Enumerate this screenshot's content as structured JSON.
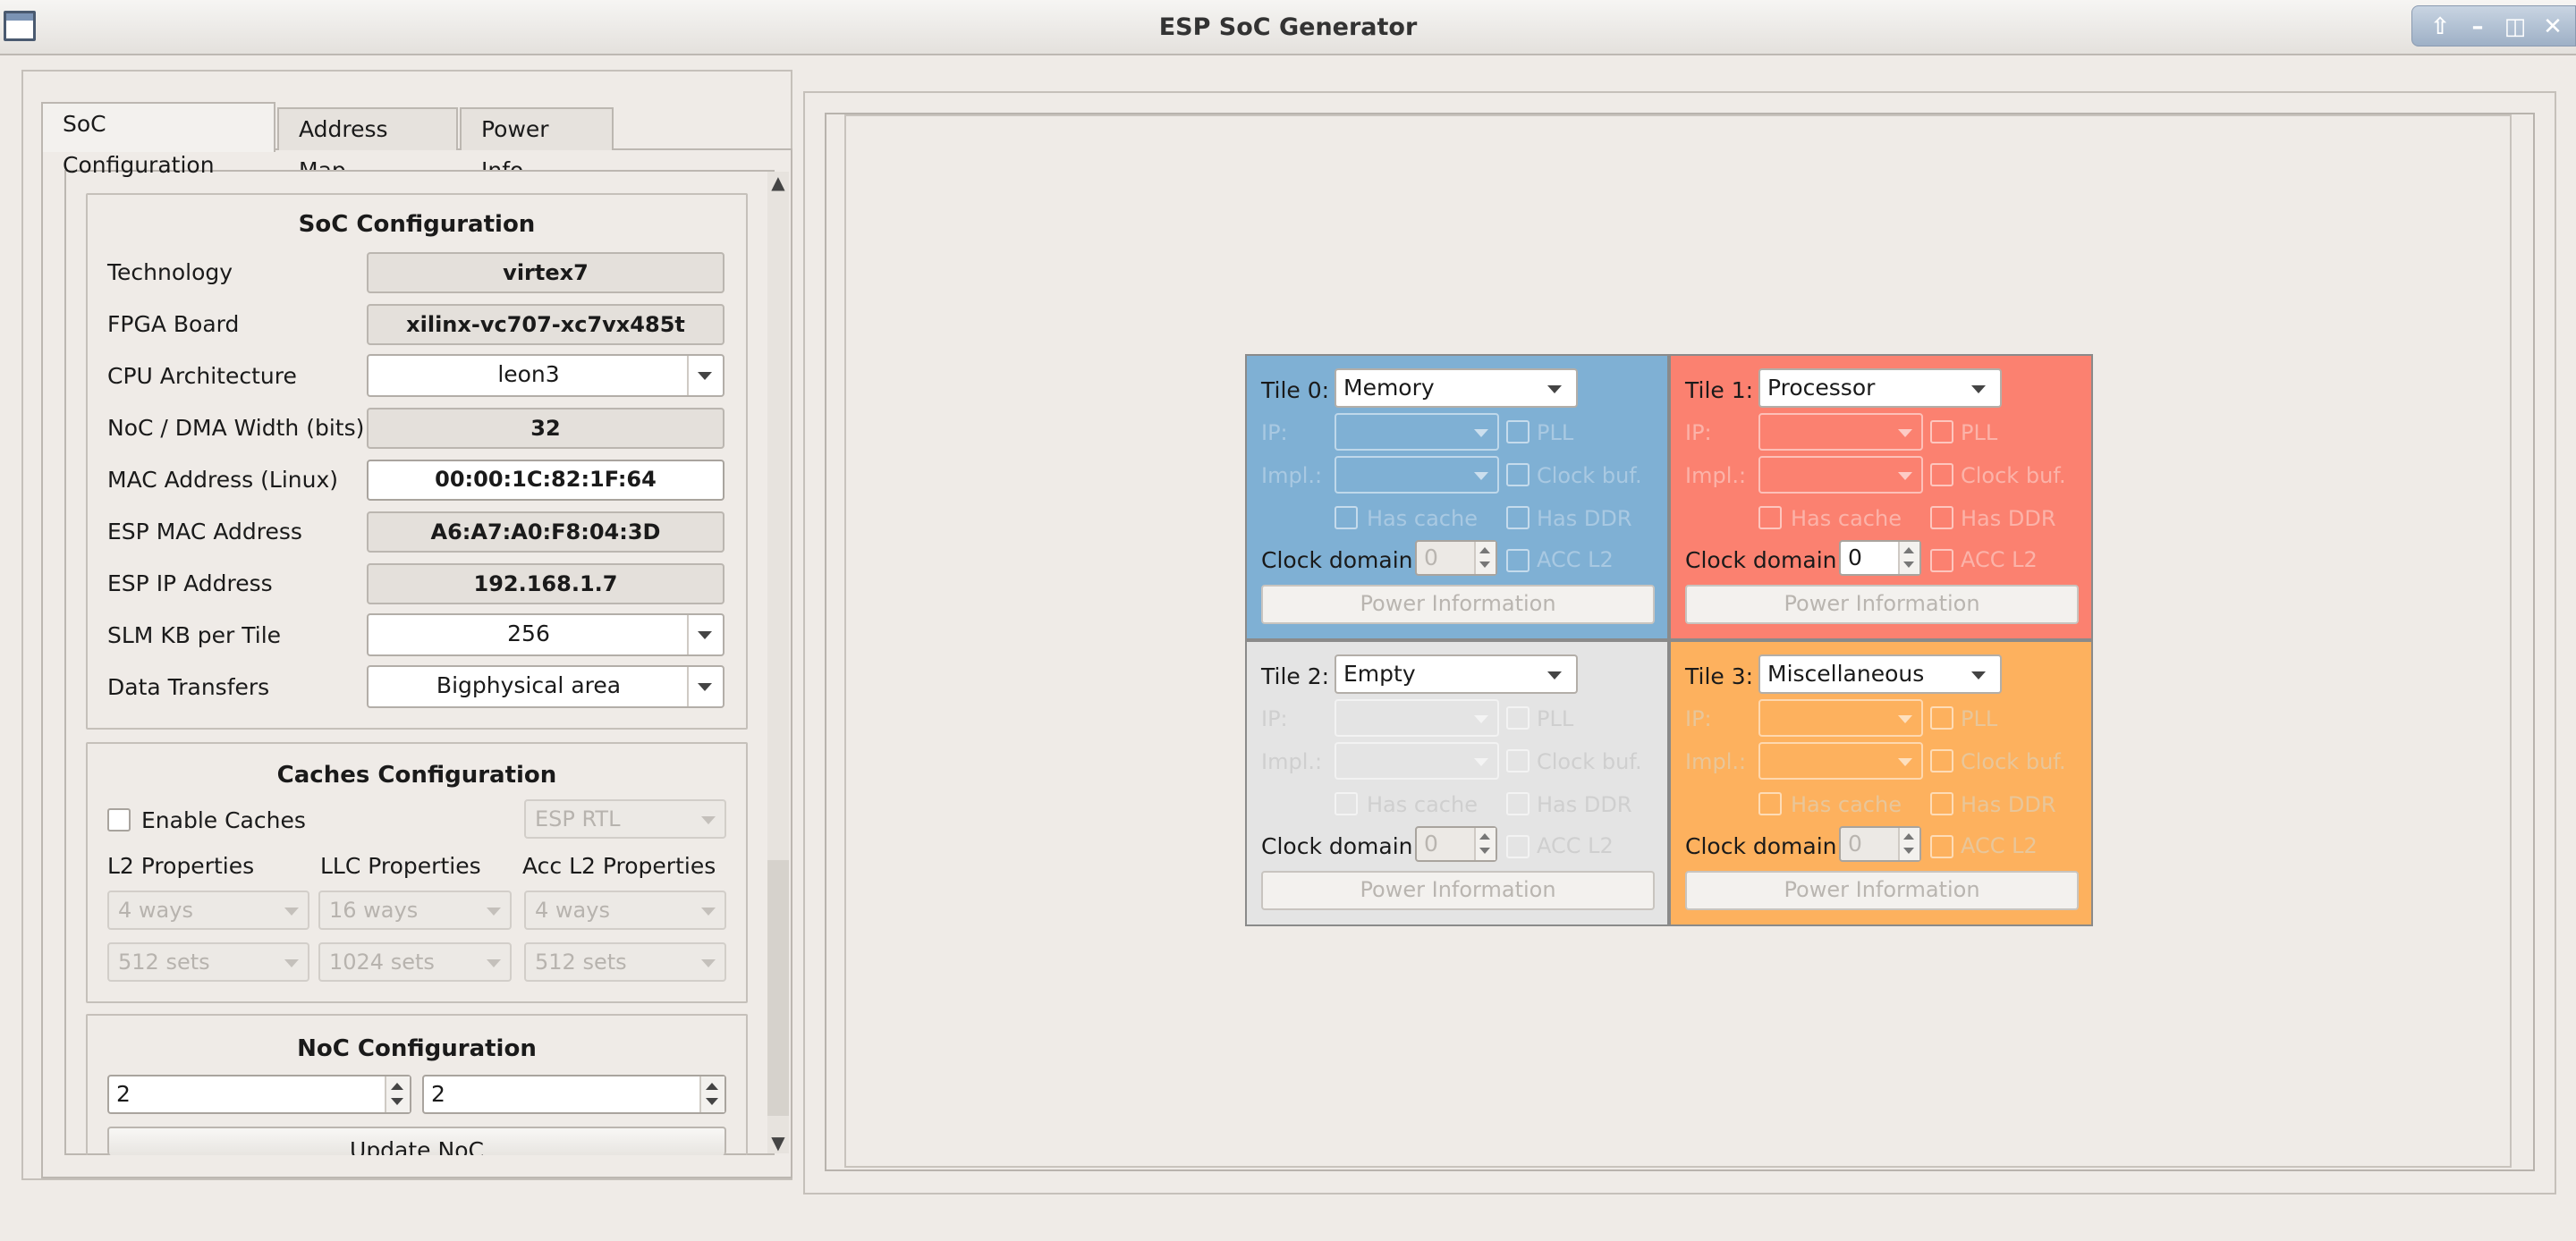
{
  "window": {
    "title": "ESP SoC Generator"
  },
  "tabs": [
    {
      "label": "SoC Configuration"
    },
    {
      "label": "Address Map"
    },
    {
      "label": "Power Info"
    }
  ],
  "soc": {
    "title": "SoC Configuration",
    "technology": {
      "label": "Technology",
      "value": "virtex7"
    },
    "fpga_board": {
      "label": "FPGA Board",
      "value": "xilinx-vc707-xc7vx485t"
    },
    "cpu_arch": {
      "label": "CPU Architecture",
      "value": "leon3"
    },
    "noc_width": {
      "label": "NoC / DMA Width (bits)",
      "value": "32"
    },
    "mac_linux": {
      "label": "MAC Address (Linux)",
      "value": "00:00:1C:82:1F:64"
    },
    "esp_mac": {
      "label": "ESP MAC Address",
      "value": "A6:A7:A0:F8:04:3D"
    },
    "esp_ip": {
      "label": "ESP IP Address",
      "value": "192.168.1.7"
    },
    "slm_kb": {
      "label": "SLM KB per Tile",
      "value": "256"
    },
    "data_transfers": {
      "label": "Data Transfers",
      "value": "Bigphysical area"
    }
  },
  "caches": {
    "title": "Caches Configuration",
    "enable_label": "Enable Caches",
    "impl": "ESP RTL",
    "l2_label": "L2 Properties",
    "llc_label": "LLC Properties",
    "accl2_label": "Acc L2 Properties",
    "l2_ways": "4 ways",
    "llc_ways": "16 ways",
    "accl2_ways": "4 ways",
    "l2_sets": "512 sets",
    "llc_sets": "1024 sets",
    "accl2_sets": "512 sets"
  },
  "noc": {
    "title": "NoC Configuration",
    "rows": "2",
    "cols": "2",
    "update_label": "Update NoC"
  },
  "tile_labels": {
    "ip": "IP:",
    "impl": "Impl.:",
    "pll": "PLL",
    "clock_buf": "Clock buf.",
    "has_cache": "Has cache",
    "has_ddr": "Has DDR",
    "clock_domain": "Clock domain:",
    "acc_l2": "ACC L2",
    "power_info": "Power Information"
  },
  "tiles": [
    {
      "label": "Tile 0:",
      "type": "Memory",
      "clock_domain": "0",
      "color": "#7fb0d4"
    },
    {
      "label": "Tile 1:",
      "type": "Processor",
      "clock_domain": "0",
      "color": "#fb8170"
    },
    {
      "label": "Tile 2:",
      "type": "Empty",
      "clock_domain": "0",
      "color": "#e4e4e4"
    },
    {
      "label": "Tile 3:",
      "type": "Miscellaneous",
      "clock_domain": "0",
      "color": "#fdb15e"
    }
  ]
}
